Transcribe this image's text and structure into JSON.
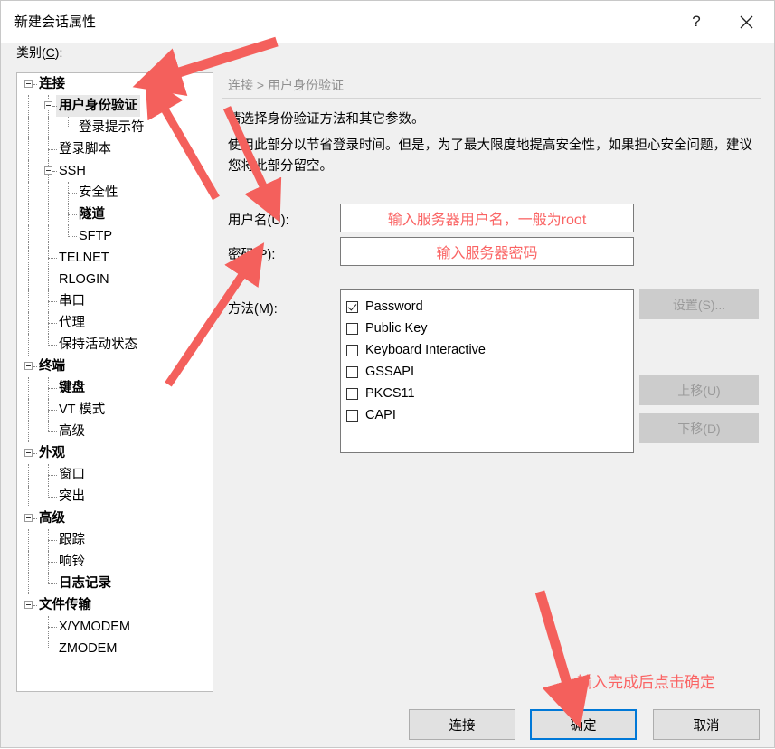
{
  "window": {
    "title": "新建会话属性",
    "help_icon": "question-mark-icon",
    "close_icon": "close-icon"
  },
  "category": {
    "label_prefix": "类别(",
    "label_key": "C",
    "label_suffix": "):"
  },
  "tree": {
    "nodes": [
      {
        "label": "连接",
        "level": 0,
        "bold": true,
        "expander": true,
        "selected": false
      },
      {
        "label": "用户身份验证",
        "level": 1,
        "bold": true,
        "expander": true,
        "selected": true
      },
      {
        "label": "登录提示符",
        "level": 2,
        "bold": false,
        "expander": false,
        "selected": false
      },
      {
        "label": "登录脚本",
        "level": 1,
        "bold": false,
        "expander": false,
        "selected": false
      },
      {
        "label": "SSH",
        "level": 1,
        "bold": false,
        "expander": true,
        "selected": false
      },
      {
        "label": "安全性",
        "level": 2,
        "bold": false,
        "expander": false,
        "selected": false
      },
      {
        "label": "隧道",
        "level": 2,
        "bold": true,
        "expander": false,
        "selected": false
      },
      {
        "label": "SFTP",
        "level": 2,
        "bold": false,
        "expander": false,
        "selected": false
      },
      {
        "label": "TELNET",
        "level": 1,
        "bold": false,
        "expander": false,
        "selected": false
      },
      {
        "label": "RLOGIN",
        "level": 1,
        "bold": false,
        "expander": false,
        "selected": false
      },
      {
        "label": "串口",
        "level": 1,
        "bold": false,
        "expander": false,
        "selected": false
      },
      {
        "label": "代理",
        "level": 1,
        "bold": false,
        "expander": false,
        "selected": false
      },
      {
        "label": "保持活动状态",
        "level": 1,
        "bold": false,
        "expander": false,
        "selected": false
      },
      {
        "label": "终端",
        "level": 0,
        "bold": true,
        "expander": true,
        "selected": false
      },
      {
        "label": "键盘",
        "level": 1,
        "bold": true,
        "expander": false,
        "selected": false
      },
      {
        "label": "VT 模式",
        "level": 1,
        "bold": false,
        "expander": false,
        "selected": false
      },
      {
        "label": "高级",
        "level": 1,
        "bold": false,
        "expander": false,
        "selected": false
      },
      {
        "label": "外观",
        "level": 0,
        "bold": true,
        "expander": true,
        "selected": false
      },
      {
        "label": "窗口",
        "level": 1,
        "bold": false,
        "expander": false,
        "selected": false
      },
      {
        "label": "突出",
        "level": 1,
        "bold": false,
        "expander": false,
        "selected": false
      },
      {
        "label": "高级",
        "level": 0,
        "bold": true,
        "expander": true,
        "selected": false
      },
      {
        "label": "跟踪",
        "level": 1,
        "bold": false,
        "expander": false,
        "selected": false
      },
      {
        "label": "响铃",
        "level": 1,
        "bold": false,
        "expander": false,
        "selected": false
      },
      {
        "label": "日志记录",
        "level": 1,
        "bold": true,
        "expander": false,
        "selected": false
      },
      {
        "label": "文件传输",
        "level": 0,
        "bold": true,
        "expander": true,
        "selected": false
      },
      {
        "label": "X/YMODEM",
        "level": 1,
        "bold": false,
        "expander": false,
        "selected": false
      },
      {
        "label": "ZMODEM",
        "level": 1,
        "bold": false,
        "expander": false,
        "selected": false
      }
    ]
  },
  "content": {
    "breadcrumb": "连接 > 用户身份验证",
    "intro_line1": "请选择身份验证方法和其它参数。",
    "intro_line2": "使用此部分以节省登录时间。但是，为了最大限度地提高安全性，如果担心安全问题，建议您将此部分留空。",
    "username_label": "用户名(U):",
    "password_label": "密码(P):",
    "method_label": "方法(M):",
    "username_value": "输入服务器用户名，一般为root",
    "password_value": "输入服务器密码",
    "methods": [
      {
        "label": "Password",
        "checked": true
      },
      {
        "label": "Public Key",
        "checked": false
      },
      {
        "label": "Keyboard Interactive",
        "checked": false
      },
      {
        "label": "GSSAPI",
        "checked": false
      },
      {
        "label": "PKCS11",
        "checked": false
      },
      {
        "label": "CAPI",
        "checked": false
      }
    ],
    "settings_button": "设置(S)...",
    "moveup_button": "上移(U)",
    "movedown_button": "下移(D)"
  },
  "footer": {
    "connect_button": "连接",
    "ok_button": "确定",
    "cancel_button": "取消"
  },
  "annotations": {
    "bottom_note": "输入完成后点击确定",
    "arrow_color": "#f4605c",
    "note_color": "#fa6464",
    "accent_color": "#0078d7"
  }
}
